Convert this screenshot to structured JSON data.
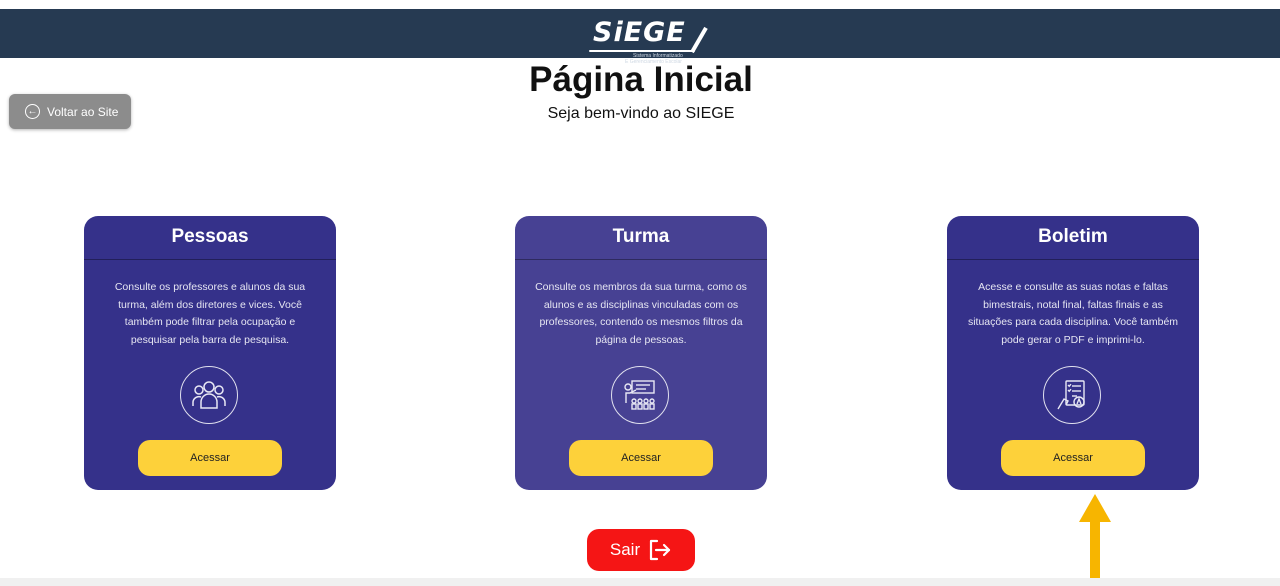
{
  "header": {
    "logo_text": "SiEGE",
    "logo_sub1": "Sistema Informatizado",
    "logo_sub2": "E Gerenciamento Escolar",
    "bg_color": "#263a52"
  },
  "back_button": {
    "label": "Voltar ao Site",
    "icon": "arrow-left-circle-icon"
  },
  "page": {
    "title": "Página Inicial",
    "subtitle": "Seja bem-vindo ao SIEGE"
  },
  "cards": [
    {
      "title": "Pessoas",
      "description": "Consulte os professores e alunos da sua turma, além dos diretores e vices. Você também pode filtrar pela ocupação e pesquisar pela barra de pesquisa.",
      "icon": "people-group-icon",
      "button_label": "Acessar"
    },
    {
      "title": "Turma",
      "description": "Consulte os membros da sua turma, como os alunos e as disciplinas vinculadas com os professores, contendo os mesmos filtros da página de pessoas.",
      "icon": "classroom-icon",
      "button_label": "Acessar"
    },
    {
      "title": "Boletim",
      "description": "Acesse e consulte as suas notas e faltas bimestrais, notal final, faltas finais e as situações para cada disciplina. Você também pode gerar o PDF e imprimi-lo.",
      "icon": "report-card-icon",
      "button_label": "Acessar"
    }
  ],
  "logout": {
    "label": "Sair",
    "icon": "logout-icon",
    "color": "#f51515"
  },
  "colors": {
    "card": "#35318a",
    "card_active": "#474193",
    "button": "#fdd13a",
    "arrow": "#f7b500"
  }
}
